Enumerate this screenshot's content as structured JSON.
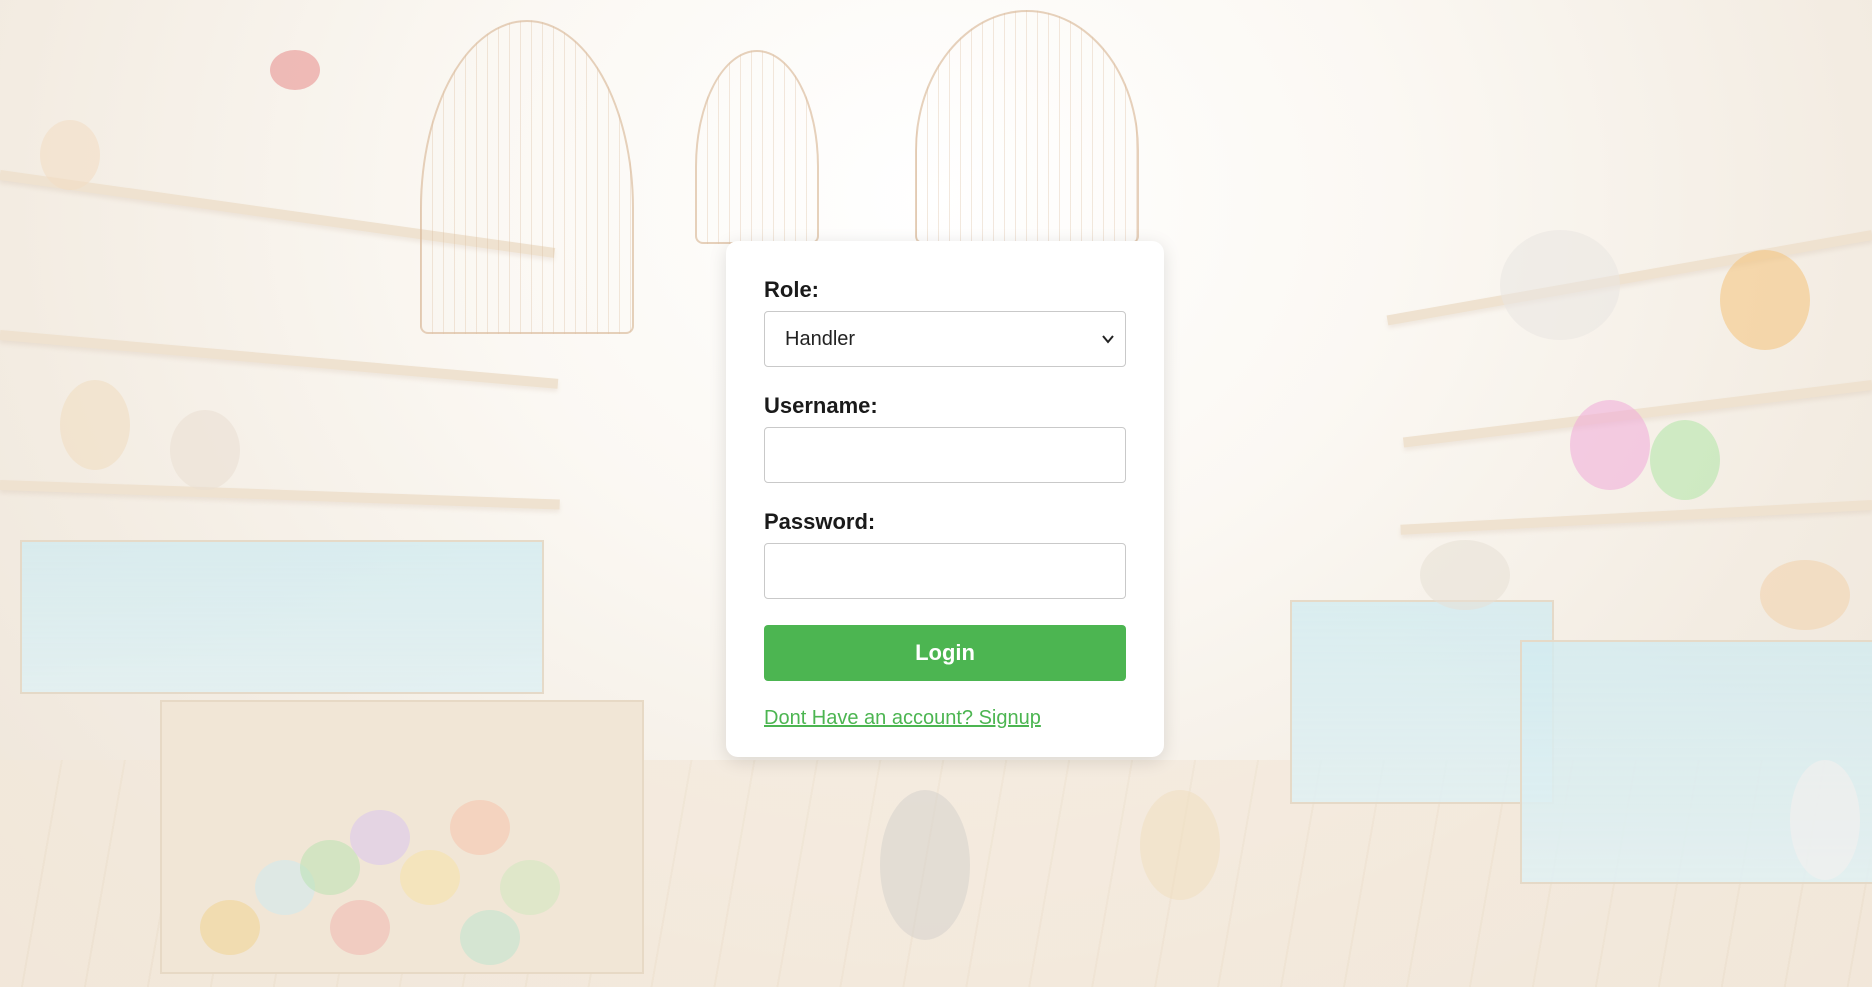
{
  "form": {
    "role_label": "Role:",
    "role_value": "Handler",
    "username_label": "Username:",
    "username_value": "",
    "password_label": "Password:",
    "password_value": "",
    "login_label": "Login",
    "signup_link": "Dont Have an account? Signup"
  },
  "colors": {
    "accent": "#4cb551",
    "card": "#ffffff"
  },
  "icons": {
    "role_dropdown": "chevron-down-icon"
  }
}
